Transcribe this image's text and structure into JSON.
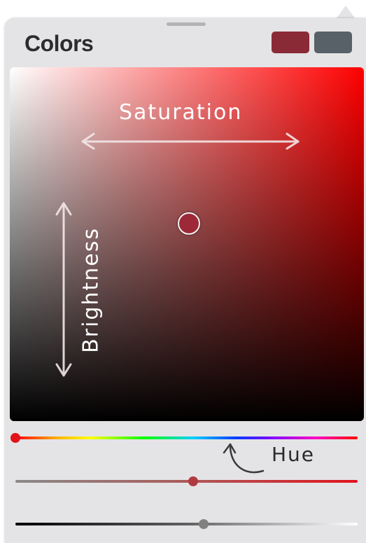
{
  "panel": {
    "title": "Colors",
    "swatches": {
      "current": "#8b2a37",
      "previous": "#586068"
    }
  },
  "picker": {
    "hue_color": "#ff0000",
    "selected_color": "#9c2838",
    "saturation": 0.5,
    "brightness": 0.6
  },
  "annotations": {
    "saturation_label": "Saturation",
    "brightness_label": "Brightness",
    "hue_label": "Hue"
  },
  "sliders": {
    "hue": {
      "value": 0.0,
      "knob_color": "#e11219"
    },
    "saturation": {
      "value": 0.52,
      "knob_color": "#b13a42"
    },
    "brightness": {
      "value": 0.55,
      "knob_color": "#808080"
    }
  }
}
